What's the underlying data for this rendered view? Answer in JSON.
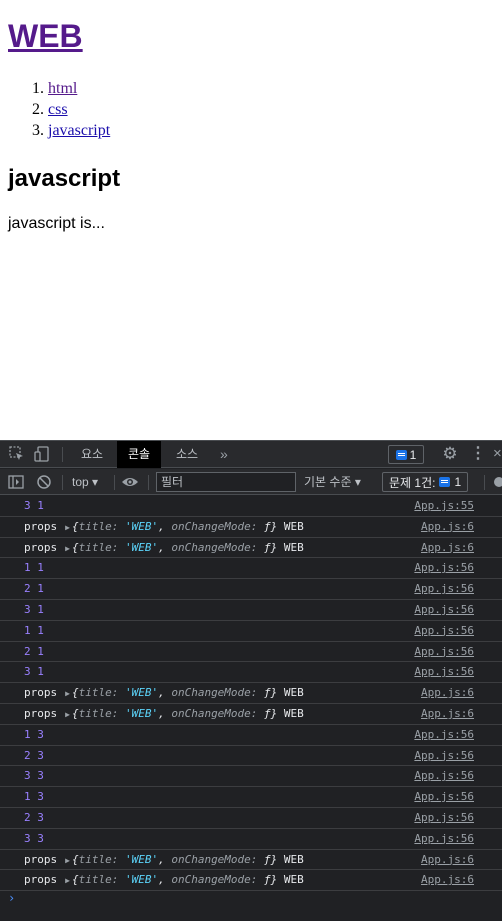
{
  "page": {
    "title": "WEB",
    "nav": [
      "html",
      "css",
      "javascript"
    ],
    "section_title": "javascript",
    "section_body": "javascript is..."
  },
  "devtools": {
    "tabs": [
      {
        "label": "요소",
        "active": false
      },
      {
        "label": "콘솔",
        "active": true
      },
      {
        "label": "소스",
        "active": false
      }
    ],
    "more_tabs_label": "»",
    "issues_count": "1",
    "toolbar": {
      "context": "top",
      "filter_placeholder": "필터",
      "level": "기본 수준",
      "issues_label": "문제 1건:",
      "issues_count": "1"
    },
    "colors": {
      "number": "#9980ff",
      "string": "#5cd5fb",
      "link": "#9aa0a6",
      "badge": "#1a73e8"
    },
    "console": [
      {
        "type": "nums",
        "text": "3 1",
        "source": "App.js:55"
      },
      {
        "type": "props",
        "label": "props",
        "title_key": "title:",
        "title_val": "'WEB'",
        "mode_key": "onChangeMode:",
        "mode_val": "ƒ}",
        "suffix": "WEB",
        "source": "App.js:6"
      },
      {
        "type": "props",
        "label": "props",
        "title_key": "title:",
        "title_val": "'WEB'",
        "mode_key": "onChangeMode:",
        "mode_val": "ƒ}",
        "suffix": "WEB",
        "source": "App.js:6"
      },
      {
        "type": "nums",
        "text": "1 1",
        "source": "App.js:56"
      },
      {
        "type": "nums",
        "text": "2 1",
        "source": "App.js:56"
      },
      {
        "type": "nums",
        "text": "3 1",
        "source": "App.js:56"
      },
      {
        "type": "nums",
        "text": "1 1",
        "source": "App.js:56"
      },
      {
        "type": "nums",
        "text": "2 1",
        "source": "App.js:56"
      },
      {
        "type": "nums",
        "text": "3 1",
        "source": "App.js:56"
      },
      {
        "type": "props",
        "label": "props",
        "title_key": "title:",
        "title_val": "'WEB'",
        "mode_key": "onChangeMode:",
        "mode_val": "ƒ}",
        "suffix": "WEB",
        "source": "App.js:6"
      },
      {
        "type": "props",
        "label": "props",
        "title_key": "title:",
        "title_val": "'WEB'",
        "mode_key": "onChangeMode:",
        "mode_val": "ƒ}",
        "suffix": "WEB",
        "source": "App.js:6"
      },
      {
        "type": "nums",
        "text": "1 3",
        "source": "App.js:56"
      },
      {
        "type": "nums",
        "text": "2 3",
        "source": "App.js:56"
      },
      {
        "type": "nums",
        "text": "3 3",
        "source": "App.js:56"
      },
      {
        "type": "nums",
        "text": "1 3",
        "source": "App.js:56"
      },
      {
        "type": "nums",
        "text": "2 3",
        "source": "App.js:56"
      },
      {
        "type": "nums",
        "text": "3 3",
        "source": "App.js:56"
      },
      {
        "type": "props",
        "label": "props",
        "title_key": "title:",
        "title_val": "'WEB'",
        "mode_key": "onChangeMode:",
        "mode_val": "ƒ}",
        "suffix": "WEB",
        "source": "App.js:6"
      },
      {
        "type": "props",
        "label": "props",
        "title_key": "title:",
        "title_val": "'WEB'",
        "mode_key": "onChangeMode:",
        "mode_val": "ƒ}",
        "suffix": "WEB",
        "source": "App.js:6"
      }
    ],
    "prompt_symbol": "›"
  }
}
